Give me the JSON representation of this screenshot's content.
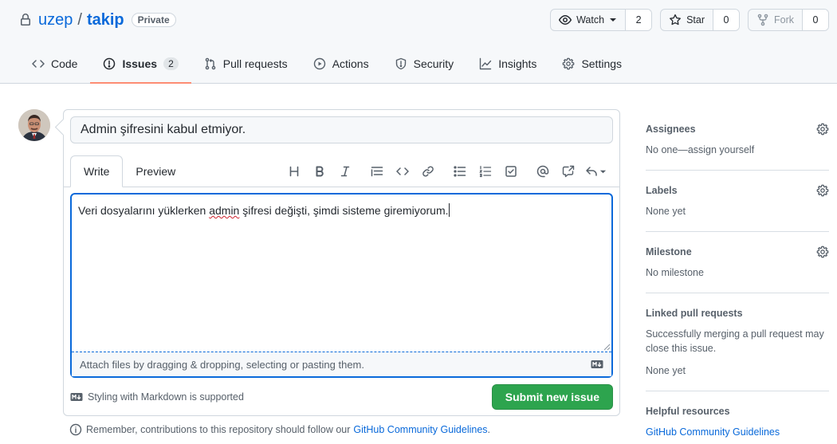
{
  "repo": {
    "owner": "uzep",
    "separator": "/",
    "name": "takip",
    "visibility": "Private"
  },
  "actions": {
    "watch_label": "Watch",
    "watch_count": "2",
    "star_label": "Star",
    "star_count": "0",
    "fork_label": "Fork",
    "fork_count": "0"
  },
  "tabs": [
    {
      "label": "Code",
      "icon": "code-icon"
    },
    {
      "label": "Issues",
      "icon": "issue-opened-icon",
      "counter": "2",
      "selected": true
    },
    {
      "label": "Pull requests",
      "icon": "git-pull-request-icon"
    },
    {
      "label": "Actions",
      "icon": "play-icon"
    },
    {
      "label": "Security",
      "icon": "shield-icon"
    },
    {
      "label": "Insights",
      "icon": "graph-icon"
    },
    {
      "label": "Settings",
      "icon": "gear-icon"
    }
  ],
  "composer": {
    "title_value": "Admin şifresini kabul etmiyor.",
    "tab_write": "Write",
    "tab_preview": "Preview",
    "body_before": "Veri dosyalarını yüklerken ",
    "body_misspelled": "admin",
    "body_after": " şifresi değişti, şimdi sisteme giremiyorum.",
    "attach_hint": "Attach files by dragging & dropping, selecting or pasting them.",
    "markdown_note": "Styling with Markdown is supported",
    "submit_label": "Submit new issue"
  },
  "toolbar_icons": [
    "heading-icon",
    "bold-icon",
    "italic-icon",
    "quote-icon",
    "code-icon",
    "link-icon",
    "unordered-list-icon",
    "ordered-list-icon",
    "tasklist-icon",
    "mention-icon",
    "cross-reference-icon",
    "reply-icon"
  ],
  "guidelines": {
    "text": "Remember, contributions to this repository should follow our",
    "link": "GitHub Community Guidelines",
    "end": "."
  },
  "sidebar": {
    "assignees": {
      "title": "Assignees",
      "value_prefix": "No one—",
      "value_link": "assign yourself"
    },
    "labels": {
      "title": "Labels",
      "value": "None yet"
    },
    "milestone": {
      "title": "Milestone",
      "value": "No milestone"
    },
    "linked": {
      "title": "Linked pull requests",
      "description": "Successfully merging a pull request may close this issue.",
      "value": "None yet"
    },
    "helpful": {
      "title": "Helpful resources",
      "link": "GitHub Community Guidelines"
    }
  },
  "colors": {
    "accent": "#0969da",
    "submit": "#2da44e",
    "selected_tab_underline": "#fd8c73"
  }
}
